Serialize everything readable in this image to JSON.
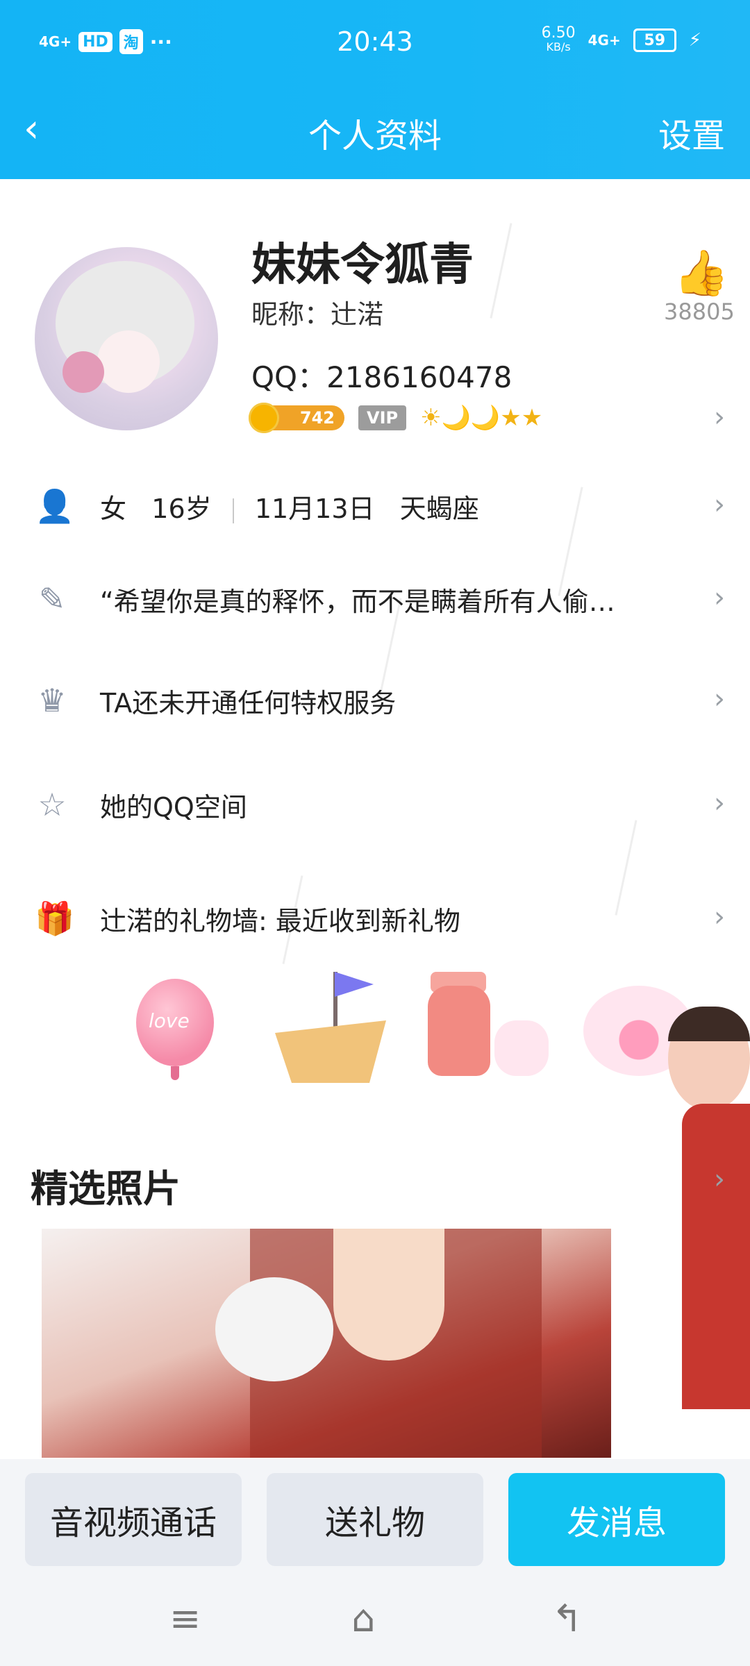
{
  "status_bar": {
    "network_left": "4G+",
    "hd_label": "HD",
    "app_badge": "淘",
    "more": "···",
    "time": "20:43",
    "speed_value": "6.50",
    "speed_unit": "KB/s",
    "network_right": "4G+",
    "battery": "59"
  },
  "nav": {
    "title": "个人资料",
    "settings": "设置"
  },
  "profile": {
    "display_name": "妹妹令狐青",
    "nickname": "昵称：辻渃",
    "qq": "QQ：2186160478",
    "coin_count": "742",
    "vip_label": "VIP",
    "level_icons": "☀🌙🌙★★",
    "like_count": "38805"
  },
  "info_rows": {
    "basic_gender": "女",
    "basic_age": "16岁",
    "basic_birthday": "11月13日",
    "basic_zodiac": "天蝎座",
    "signature": "“希望你是真的释怀，而不是瞒着所有人偷…",
    "privilege": "TA还未开通任何特权服务",
    "qzone": "她的QQ空间",
    "gift_wall": "辻渃的礼物墙: 最近收到新礼物"
  },
  "gifts": {
    "balloon_text": "love"
  },
  "photos": {
    "section_title": "精选照片"
  },
  "actions": {
    "call": "音视频通话",
    "gift": "送礼物",
    "message": "发消息"
  }
}
